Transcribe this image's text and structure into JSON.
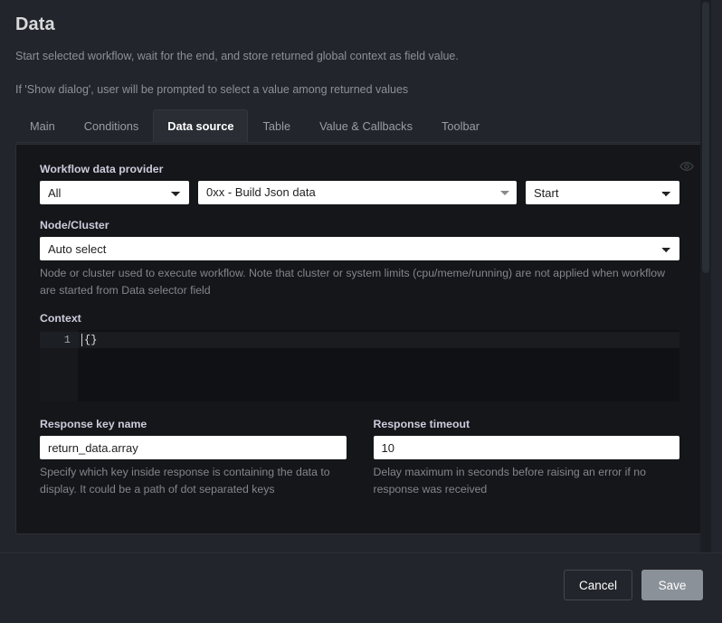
{
  "dialog": {
    "title": "Data",
    "description_1": "Start selected workflow, wait for the end, and store returned global context as field value.",
    "description_2": "If 'Show dialog', user will be prompted to select a value among returned values"
  },
  "tabs": [
    {
      "label": "Main",
      "active": false
    },
    {
      "label": "Conditions",
      "active": false
    },
    {
      "label": "Data source",
      "active": true
    },
    {
      "label": "Table",
      "active": false
    },
    {
      "label": "Value & Callbacks",
      "active": false
    },
    {
      "label": "Toolbar",
      "active": false
    }
  ],
  "form": {
    "workflow_data_provider": {
      "label": "Workflow data provider",
      "scope_value": "All",
      "scope_options": [
        "All"
      ],
      "workflow_value": "0xx - Build Json data",
      "action_value": "Start",
      "action_options": [
        "Start"
      ],
      "eye_icon": "eye-icon"
    },
    "node_cluster": {
      "label": "Node/Cluster",
      "value": "Auto select",
      "options": [
        "Auto select"
      ],
      "help": "Node or cluster used to execute workflow. Note that cluster or system limits (cpu/meme/running) are not applied when workflow are started from Data selector field"
    },
    "context": {
      "label": "Context",
      "lines": [
        "{}"
      ],
      "line_numbers": [
        "1"
      ]
    },
    "response_key_name": {
      "label": "Response key name",
      "value": "return_data.array",
      "help": "Specify which key inside response is containing the data to display. It could be a path of dot separated keys"
    },
    "response_timeout": {
      "label": "Response timeout",
      "value": "10",
      "help": "Delay maximum in seconds before raising an error if no response was received"
    }
  },
  "footer": {
    "cancel_label": "Cancel",
    "save_label": "Save"
  },
  "colors": {
    "background": "#22252b",
    "panel": "#141619",
    "accent_text": "#ffffff",
    "muted_text": "#8e9095",
    "save_button": "#8b9199"
  }
}
